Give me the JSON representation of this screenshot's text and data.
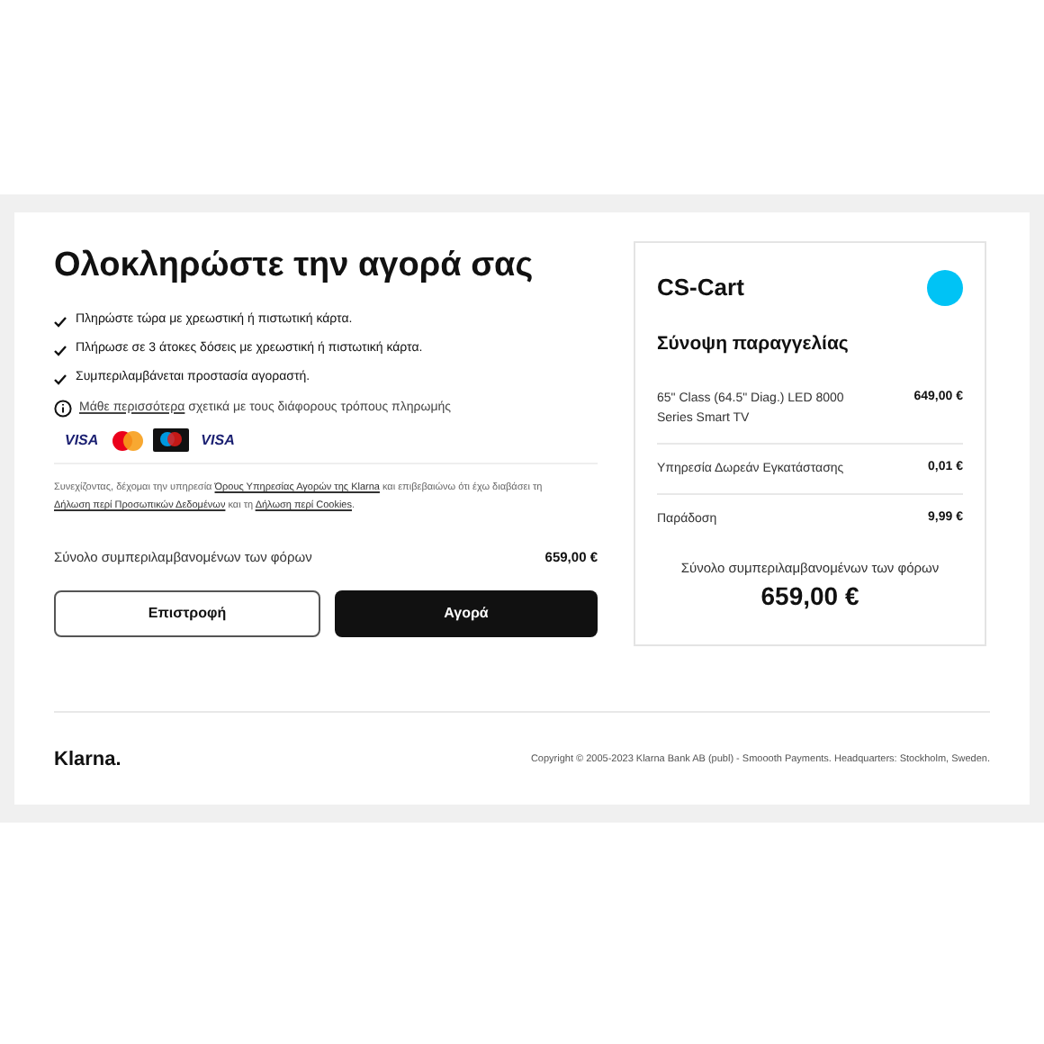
{
  "checkout": {
    "title": "Ολοκληρώστε την αγορά σας",
    "benefits": [
      "Πληρώστε τώρα με χρεωστική ή πιστωτική κάρτα.",
      "Πλήρωσε σε 3 άτοκες δόσεις με χρεωστική ή πιστωτική κάρτα.",
      "Συμπεριλαμβάνεται προστασία αγοραστή."
    ],
    "learn_more": {
      "link": "Μάθε περισσότερα",
      "text": "σχετικά με τους διάφορους τρόπους πληρωμής"
    },
    "payment_methods": [
      {
        "kind": "visa",
        "label": "VISA"
      },
      {
        "kind": "mastercard"
      },
      {
        "kind": "maestro"
      },
      {
        "kind": "visa",
        "label": "VISA"
      }
    ],
    "consent": [
      {
        "kind": "text",
        "text": "Συνεχίζοντας, δέχομαι την υπηρεσία "
      },
      {
        "kind": "link",
        "text": "Όρους Υπηρεσίας Αγορών της Klarna"
      },
      {
        "kind": "text",
        "text": " και επιβεβαιώνω ότι έχω διαβάσει τη "
      },
      {
        "kind": "link",
        "text": "Δήλωση περί Προσωπικών Δεδομένων"
      },
      {
        "kind": "text",
        "text": " και τη "
      },
      {
        "kind": "link",
        "text": "Δήλωση περί Cookies"
      },
      {
        "kind": "text",
        "text": "."
      }
    ],
    "total_label": "Σύνολο συμπεριλαμβανομένων των φόρων",
    "total_value": "659,00 €",
    "buttons": [
      {
        "kind": "secondary",
        "label": "Επιστροφή"
      },
      {
        "kind": "primary",
        "label": "Αγορά"
      }
    ]
  },
  "summary": {
    "store": "CS-Cart",
    "title": "Σύνοψη παραγγελίας",
    "items": [
      {
        "name": "65\" Class (64.5\" Diag.) LED 8000 Series Smart TV",
        "price": "649,00 €"
      },
      {
        "name": "Υπηρεσία Δωρεάν Εγκατάστασης",
        "price": "0,01 €"
      },
      {
        "name": "Παράδοση",
        "price": "9,99 €"
      }
    ],
    "total_label": "Σύνολο συμπεριλαμβανομένων των φόρων",
    "total_value": "659,00 €"
  },
  "footer": {
    "logo": "Klarna.",
    "copyright": "Copyright © 2005-2023 Klarna Bank AB (publ) - Smoooth Payments. Headquarters: Stockholm, Sweden."
  }
}
